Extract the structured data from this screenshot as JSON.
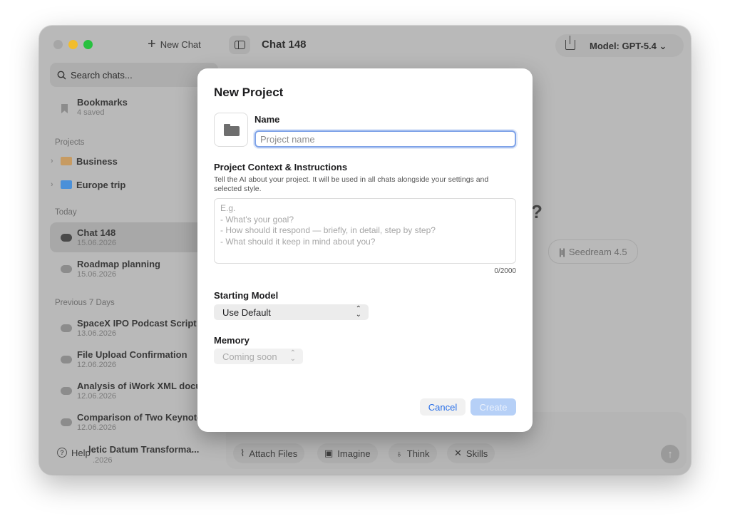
{
  "sidebar": {
    "new_chat_label": "New Chat",
    "search_placeholder": "Search chats...",
    "bookmarks": {
      "title": "Bookmarks",
      "count": "4 saved"
    },
    "projects_header": "Projects",
    "projects": [
      {
        "name": "Business",
        "icon": "briefcase-icon",
        "color": "#c79b62"
      },
      {
        "name": "Europe trip",
        "icon": "folder-icon",
        "color": "#4a90d9"
      }
    ],
    "today_header": "Today",
    "today_chats": [
      {
        "title": "Chat 148",
        "date": "15.06.2026"
      },
      {
        "title": "Roadmap planning",
        "date": "15.06.2026"
      }
    ],
    "prev7_header": "Previous 7 Days",
    "prev7_chats": [
      {
        "title": "SpaceX IPO Podcast Script",
        "date": "13.06.2026"
      },
      {
        "title": "File Upload Confirmation",
        "date": "12.06.2026"
      },
      {
        "title": "Analysis of iWork XML docu",
        "date": "12.06.2026"
      },
      {
        "title": "Comparison of Two Keynote",
        "date": "12.06.2026"
      },
      {
        "title": "letic Datum Transforma...",
        "date": ".2026"
      }
    ],
    "help_label": "Help"
  },
  "main": {
    "chat_title": "Chat 148",
    "model_label": "Model: GPT-5.4",
    "question_mark": "?",
    "seedream_label": "Seedream 4.5",
    "tools": [
      "Attach Files",
      "Imagine",
      "Think",
      "Skills"
    ],
    "send_icon": "↑"
  },
  "dialog": {
    "title": "New Project",
    "name_label": "Name",
    "name_placeholder": "Project name",
    "context_label": "Project Context & Instructions",
    "context_description": "Tell the AI about your project. It will be used in all chats alongside your settings and selected style.",
    "context_placeholder": "E.g.\n- What's your goal?\n- How should it respond — briefly, in detail, step by step?\n- What should it keep in mind about you?",
    "char_counter": "0/2000",
    "starting_model_label": "Starting Model",
    "starting_model_value": "Use Default",
    "memory_label": "Memory",
    "memory_value": "Coming soon",
    "cancel_label": "Cancel",
    "create_label": "Create"
  },
  "colors": {
    "accent": "#2a70e8",
    "focus_ring": "#7fa3e8",
    "create_disabled": "#b6d0f7",
    "traffic_min": "#f2bd2c",
    "traffic_max": "#27c13f"
  }
}
